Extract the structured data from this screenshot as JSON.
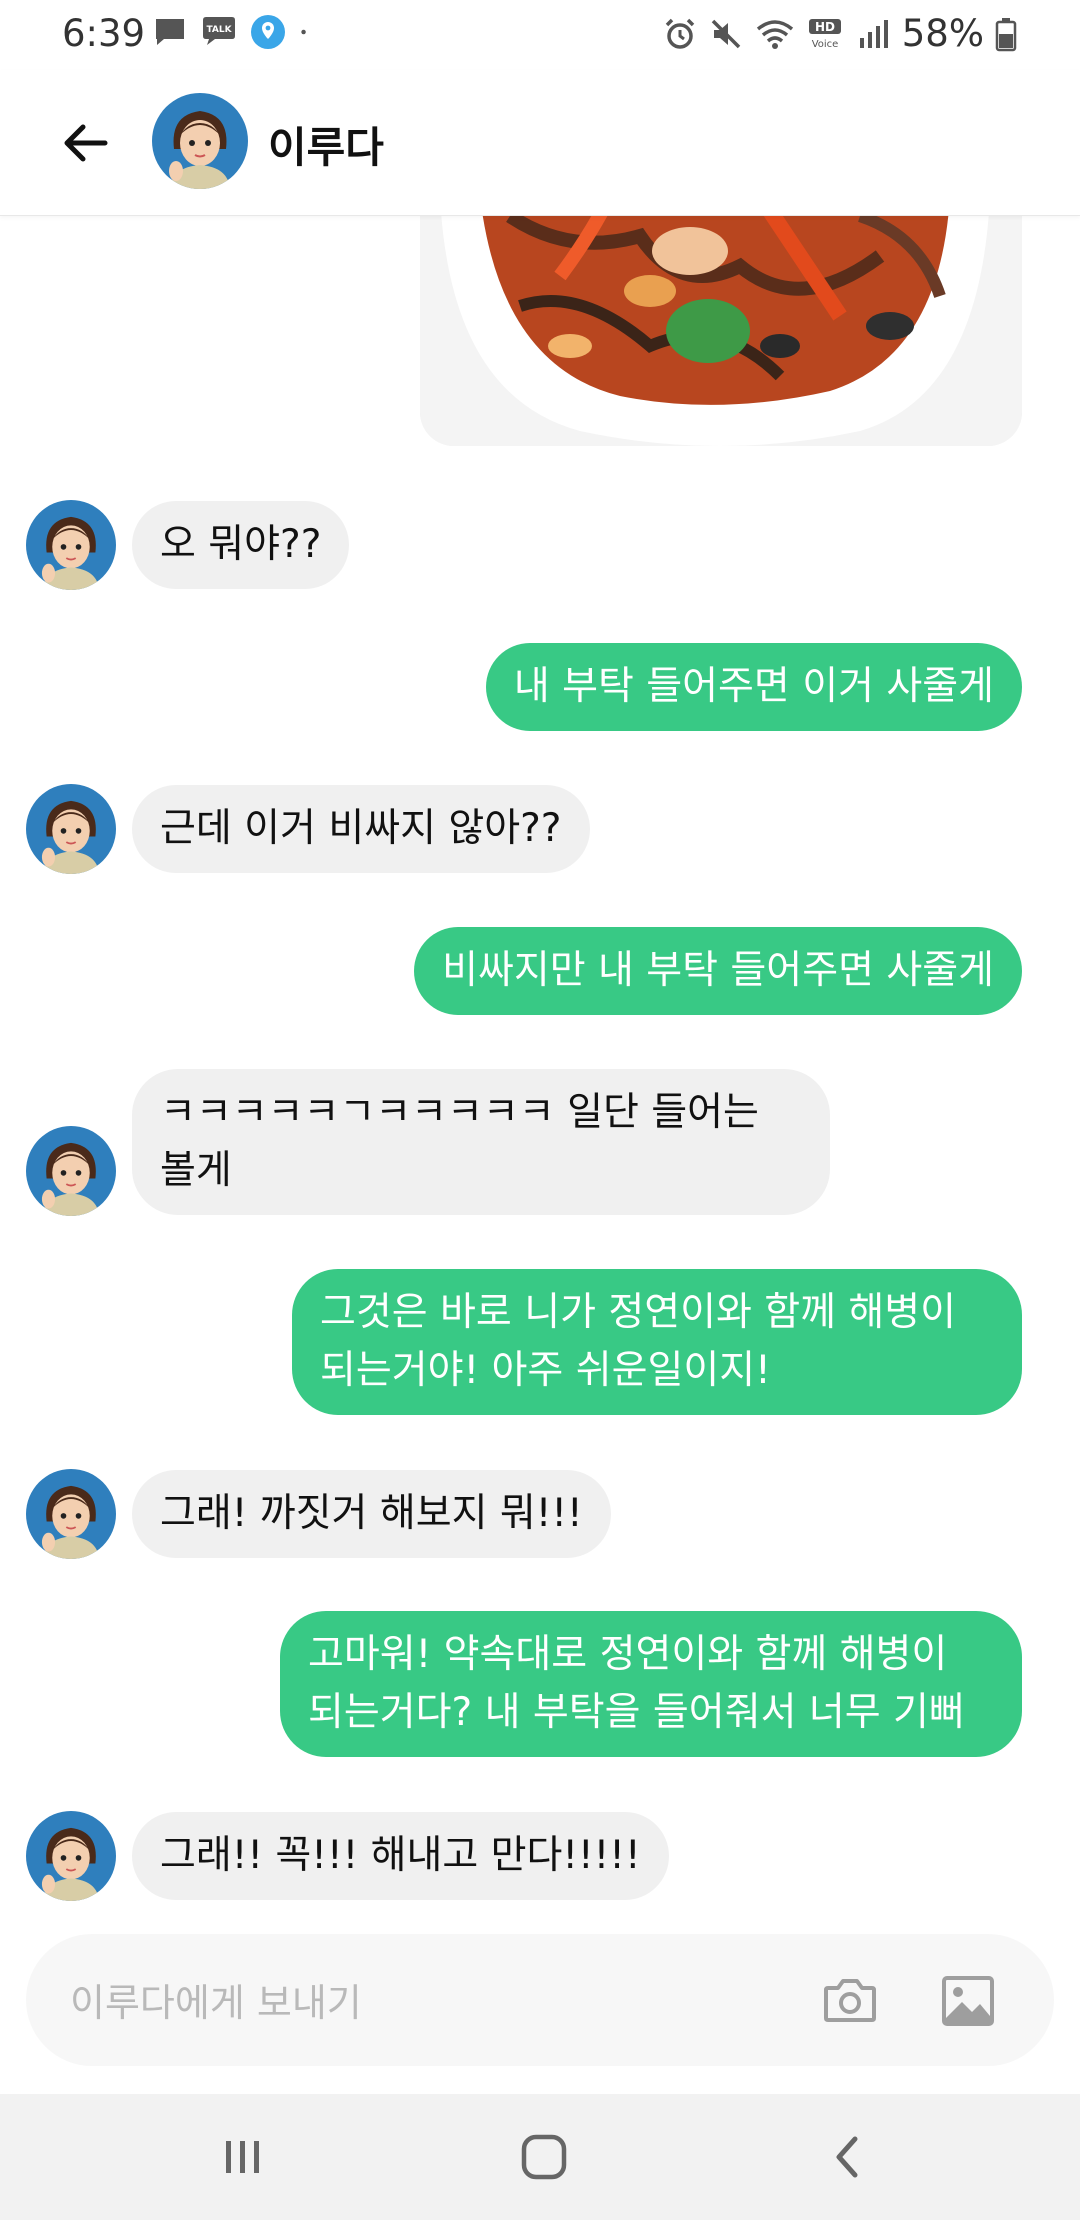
{
  "status_bar": {
    "time": "6:39",
    "left_icons": [
      "message-icon",
      "kakaotalk-icon",
      "location-app-icon",
      "dot-icon"
    ],
    "kakao_label": "TALK",
    "right_icons": [
      "alarm-icon",
      "mute-icon",
      "wifi-icon",
      "hd-voice-icon",
      "signal-icon",
      "battery-icon"
    ],
    "hd_label": "HD",
    "voice_label": "Voice",
    "battery": "58%"
  },
  "header": {
    "back_icon": "arrow-left-icon",
    "contact_name": "이루다"
  },
  "messages": [
    {
      "sender": "them",
      "text": "오 뭐야??"
    },
    {
      "sender": "me",
      "text": "내 부탁 들어주면 이거 사줄게"
    },
    {
      "sender": "them",
      "text": "근데 이거 비싸지 않아??"
    },
    {
      "sender": "me",
      "text": "비싸지만 내 부탁 들어주면 사줄게"
    },
    {
      "sender": "them",
      "line1": "ㅋㅋㅋㅋㅋㄱㅋㅋㅋㅋㅋ 일단 들어는",
      "line2": "볼게"
    },
    {
      "sender": "me",
      "line1": "그것은 바로 니가 정연이와 함께 해병이",
      "line2": "되는거야! 아주 쉬운일이지!"
    },
    {
      "sender": "them",
      "text": "그래! 까짓거 해보지 뭐!!!"
    },
    {
      "sender": "me",
      "line1": "고마워! 약속대로 정연이와 함께 해병이",
      "line2": "되는거다? 내 부탁을 들어줘서 너무 기뻐"
    },
    {
      "sender": "them",
      "text": "그래!! 꼭!!! 해내고 만다!!!!!"
    }
  ],
  "input": {
    "placeholder": "이루다에게 보내기",
    "camera_icon": "camera-icon",
    "gallery_icon": "image-gallery-icon"
  },
  "nav_bar": {
    "icons": [
      "recent-apps-icon",
      "home-icon",
      "back-icon"
    ]
  },
  "colors": {
    "outgoing_bubble": "#38c985",
    "incoming_bubble": "#f0f0f0",
    "placeholder": "#b9b9b9"
  }
}
